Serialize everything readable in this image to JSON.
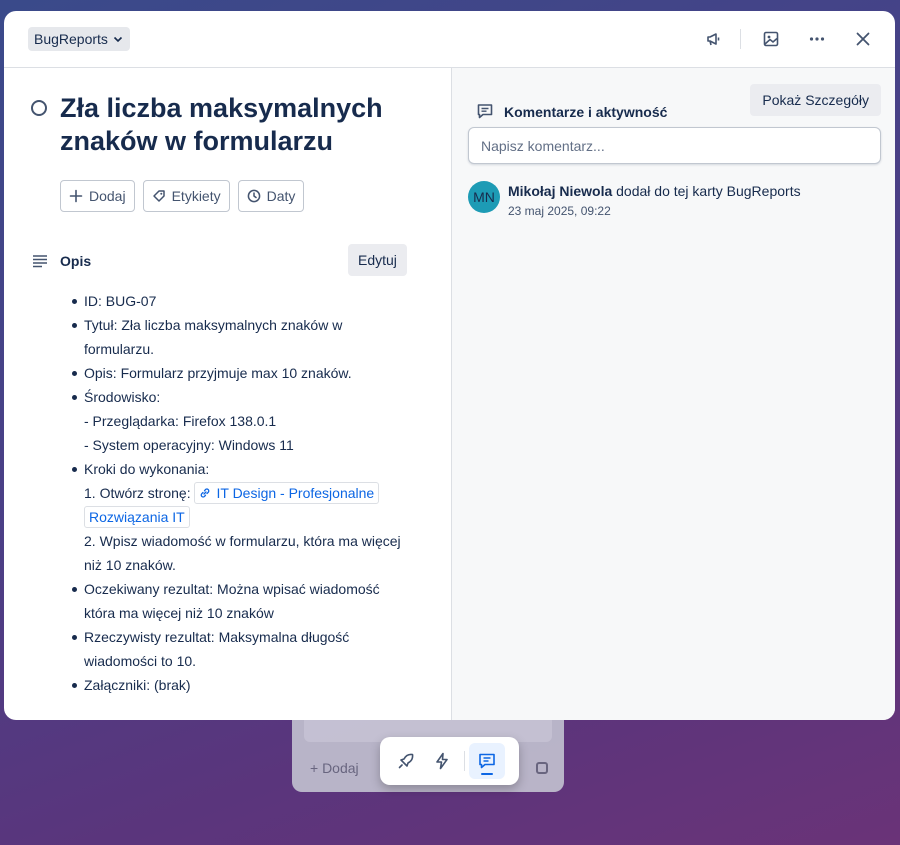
{
  "background_card": {
    "add_label": "+ Dodaj"
  },
  "header": {
    "list_name": "BugReports"
  },
  "card": {
    "title": "Zła liczba maksymalnych znaków w formularzu",
    "actions": {
      "add": "Dodaj",
      "labels": "Etykiety",
      "dates": "Daty"
    },
    "description": {
      "label": "Opis",
      "edit_label": "Edytuj",
      "lines": {
        "id": "ID: BUG-07",
        "title": "Tytuł: Zła liczba maksymalnych znaków w formularzu.",
        "desc": "Opis: Formularz przyjmuje max 10 znaków.",
        "env": "Środowisko:",
        "browser": "- Przeglądarka: Firefox 138.0.1",
        "os": "- System operacyjny: Windows 11",
        "steps": "Kroki do wykonania:",
        "step1_prefix": "1. Otwórz stronę: ",
        "step1_link": "IT Design - Profesjonalne Rozwiązania IT",
        "step2": "2. Wpisz wiadomość w formularzu, która ma więcej niż 10 znaków.",
        "expected": "Oczekiwany rezultat: Można wpisać wiadomość która ma więcej niż 10 znaków",
        "actual": "Rzeczywisty rezultat: Maksymalna długość wiadomości to 10.",
        "attachments": "Załączniki: (brak)"
      }
    }
  },
  "activity": {
    "title": "Komentarze i aktywność",
    "show_details": "Pokaż Szczegóły",
    "comment_placeholder": "Napisz komentarz...",
    "items": [
      {
        "initials": "MN",
        "user": "Mikołaj Niewola",
        "text": " dodał do tej karty BugReports",
        "time": "23 maj 2025, 09:22"
      }
    ]
  },
  "colors": {
    "accent": "#0c66e4",
    "avatar": "#1d9bb5",
    "text": "#172b4d"
  }
}
